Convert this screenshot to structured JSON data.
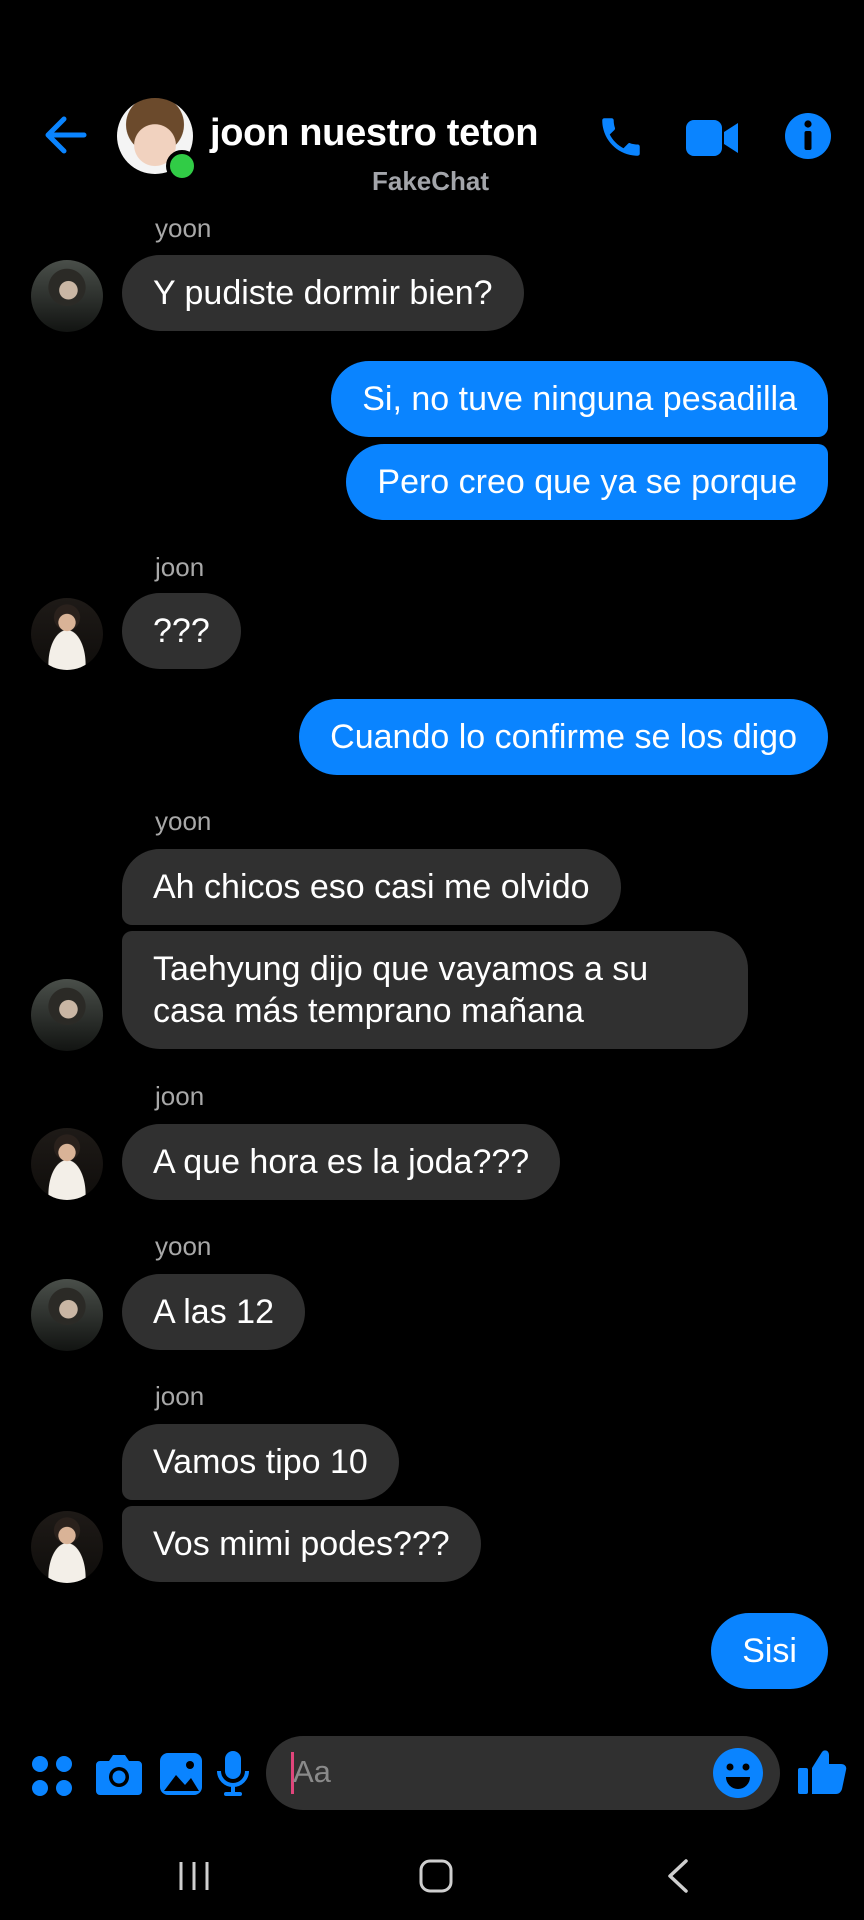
{
  "header": {
    "title": "joon nuestro teton",
    "subtitle": "FakeChat",
    "icons": [
      "back-arrow-icon",
      "phone-icon",
      "video-camera-icon",
      "info-icon"
    ]
  },
  "messages": [
    {
      "sender": "yoon",
      "text": "Y pudiste dormir bien?",
      "direction": "incoming"
    },
    {
      "text": "Si, no tuve ninguna pesadilla",
      "direction": "outgoing"
    },
    {
      "text": "Pero creo que ya se porque",
      "direction": "outgoing"
    },
    {
      "sender": "joon",
      "text": "???",
      "direction": "incoming"
    },
    {
      "text": "Cuando lo confirme se los digo",
      "direction": "outgoing"
    },
    {
      "sender": "yoon",
      "text": "Ah chicos eso casi me olvido",
      "direction": "incoming"
    },
    {
      "text": "Taehyung dijo que vayamos a su casa más temprano mañana",
      "direction": "incoming"
    },
    {
      "sender": "joon",
      "text": "A que hora es la joda???",
      "direction": "incoming"
    },
    {
      "sender": "yoon",
      "text": "A las 12",
      "direction": "incoming"
    },
    {
      "sender": "joon",
      "text": "Vamos tipo 10",
      "direction": "incoming"
    },
    {
      "text": "Vos mimi podes???",
      "direction": "incoming"
    },
    {
      "text": "Sisi",
      "direction": "outgoing"
    }
  ],
  "composer": {
    "placeholder": "Aa",
    "icons": [
      "apps-icon",
      "camera-icon",
      "gallery-icon",
      "microphone-icon",
      "emoji-icon",
      "thumbs-up-icon"
    ]
  },
  "colors": {
    "accent": "#0a84ff",
    "incoming_bubble": "#303030",
    "background": "#000000",
    "online": "#31cc46"
  }
}
